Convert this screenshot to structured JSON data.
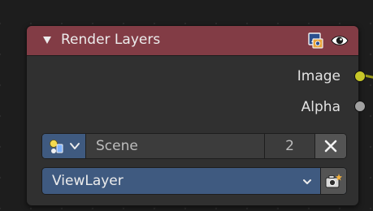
{
  "node": {
    "title": "Render Layers",
    "header_color": "#823c45",
    "header_icons": [
      "render-icon",
      "eye-icon"
    ]
  },
  "outputs": [
    {
      "label": "Image",
      "socket_color": "#c7c729"
    },
    {
      "label": "Alpha",
      "socket_color": "#a1a1a1"
    }
  ],
  "scene": {
    "type_icon": "scene-icon",
    "name": "Scene",
    "users": "2",
    "unlink_icon": "close-icon"
  },
  "view_layer": {
    "name": "ViewLayer",
    "render_icon": "camera-render-icon"
  },
  "colors": {
    "accent_blue": "#3f5a80",
    "background": "#1d1d1d",
    "node_body": "#303030"
  }
}
